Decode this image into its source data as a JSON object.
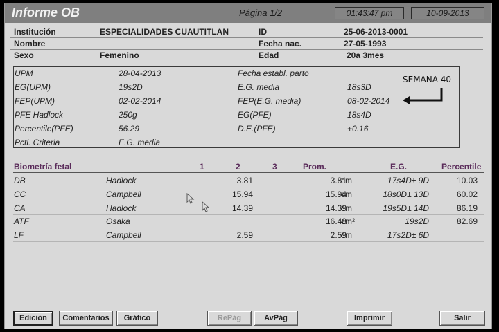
{
  "header": {
    "title": "Informe OB",
    "page": "Página 1/2",
    "time": "01:43:47 pm",
    "date": "10-09-2013"
  },
  "patient": {
    "institucion_label": "Institución",
    "institucion_value": "ESPECIALIDADES CUAUTITLAN",
    "nombre_label": "Nombre",
    "sexo_label": "Sexo",
    "sexo_value": "Femenino",
    "id_label": "ID",
    "id_value": "25-06-2013-0001",
    "fecha_nac_label": "Fecha nac.",
    "fecha_nac_value": "27-05-1993",
    "edad_label": "Edad",
    "edad_value": "20a 3mes"
  },
  "ob": {
    "upm_label": "UPM",
    "upm_value": "28-04-2013",
    "eg_upm_label": "EG(UPM)",
    "eg_upm_value": "19s2D",
    "fep_upm_label": "FEP(UPM)",
    "fep_upm_value": "02-02-2014",
    "pfe_label": "PFE Hadlock",
    "pfe_value": "250g",
    "percentile_label": "Percentile(PFE)",
    "percentile_value": "56.29",
    "pctl_label": "Pctl. Criteria",
    "pctl_value": "E.G. media",
    "fecha_parto_label": "Fecha establ. parto",
    "eg_media_label": "E.G. media",
    "eg_media_value": "18s3D",
    "fep_eg_label": "FEP(E.G. media)",
    "fep_eg_value": "08-02-2014",
    "eg_pfe_label": "EG(PFE)",
    "eg_pfe_value": "18s4D",
    "de_pfe_label": "D.E.(PFE)",
    "de_pfe_value": "+0.16"
  },
  "annotation": {
    "text": "SEMANA 40"
  },
  "biometry": {
    "title": "Biometría fetal",
    "col1": "1",
    "col2": "2",
    "col3": "3",
    "prom": "Prom.",
    "eg": "E.G.",
    "percentile": "Percentile",
    "rows": [
      {
        "name": "DB",
        "author": "Hadlock",
        "v2": "3.81",
        "prom": "3.81",
        "unit": "cm",
        "eg": "17s4D± 9D",
        "pct": "10.03"
      },
      {
        "name": "CC",
        "author": "Campbell",
        "v2": "15.94",
        "prom": "15.94",
        "unit": "cm",
        "eg": "18s0D± 13D",
        "pct": "60.02"
      },
      {
        "name": "CA",
        "author": "Hadlock",
        "v2": "14.39",
        "prom": "14.39",
        "unit": "cm",
        "eg": "19s5D± 14D",
        "pct": "86.19"
      },
      {
        "name": "ATF",
        "author": "Osaka",
        "v2": "",
        "prom": "16.48",
        "unit": "cm²",
        "eg": "19s2D",
        "pct": "82.69"
      },
      {
        "name": "LF",
        "author": "Campbell",
        "v2": "2.59",
        "prom": "2.59",
        "unit": "cm",
        "eg": "17s2D± 6D",
        "pct": ""
      }
    ]
  },
  "buttons": {
    "edicion": "Edición",
    "comentarios": "Comentarios",
    "grafico": "Gráfico",
    "repag": "RePág",
    "avpag": "AvPág",
    "imprimir": "Imprimir",
    "salir": "Salir"
  }
}
